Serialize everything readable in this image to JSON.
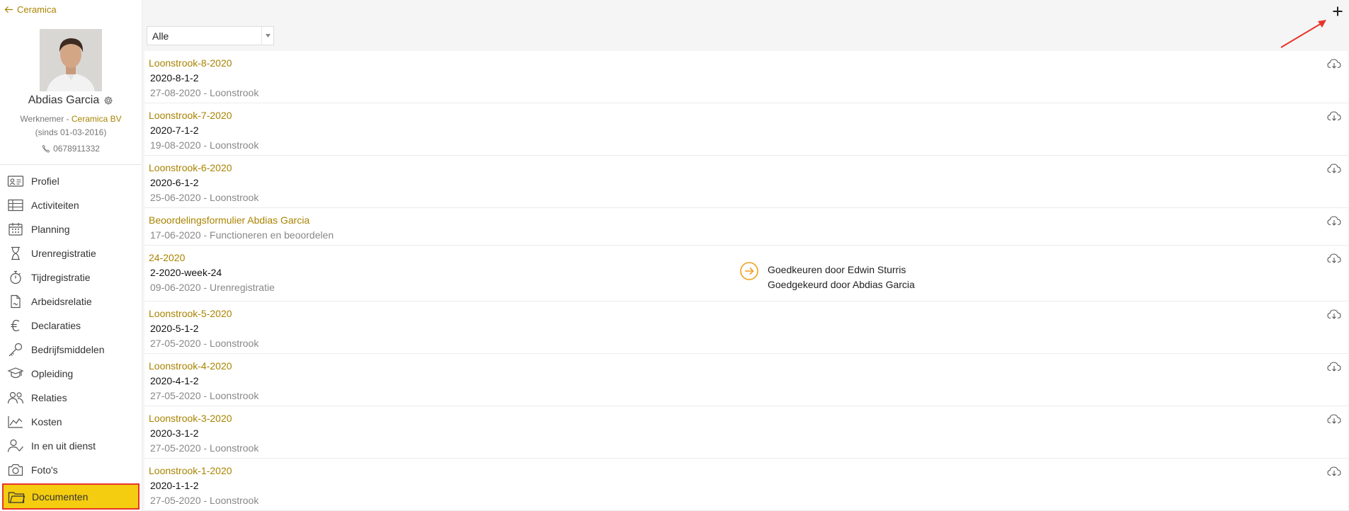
{
  "sidebar": {
    "back_label": "Ceramica",
    "user": {
      "name": "Abdias Garcia",
      "role": "Werknemer - ",
      "company": "Ceramica BV",
      "since": "(sinds 01-03-2016)",
      "phone": "0678911332"
    },
    "items": [
      {
        "label": "Profiel",
        "icon": "profile-card-icon"
      },
      {
        "label": "Activiteiten",
        "icon": "table-icon"
      },
      {
        "label": "Planning",
        "icon": "calendar-icon"
      },
      {
        "label": "Urenregistratie",
        "icon": "hourglass-icon"
      },
      {
        "label": "Tijdregistratie",
        "icon": "stopwatch-icon"
      },
      {
        "label": "Arbeidsrelatie",
        "icon": "document-icon"
      },
      {
        "label": "Declaraties",
        "icon": "euro-icon"
      },
      {
        "label": "Bedrijfsmiddelen",
        "icon": "key-icon"
      },
      {
        "label": "Opleiding",
        "icon": "graduation-icon"
      },
      {
        "label": "Relaties",
        "icon": "people-icon"
      },
      {
        "label": "Kosten",
        "icon": "area-chart-icon"
      },
      {
        "label": "In en uit dienst",
        "icon": "user-check-icon"
      },
      {
        "label": "Foto's",
        "icon": "camera-icon"
      },
      {
        "label": "Documenten",
        "icon": "folder-icon",
        "active": true
      }
    ]
  },
  "main": {
    "filter": {
      "selected": "Alle"
    },
    "documents": [
      {
        "title": "Loonstrook-8-2020",
        "sub": "2020-8-1-2",
        "meta": "27-08-2020 - Loonstrook"
      },
      {
        "title": "Loonstrook-7-2020",
        "sub": "2020-7-1-2",
        "meta": "19-08-2020 - Loonstrook"
      },
      {
        "title": "Loonstrook-6-2020",
        "sub": "2020-6-1-2",
        "meta": "25-06-2020 - Loonstrook"
      },
      {
        "title": "Beoordelingsformulier Abdias Garcia",
        "meta": "17-06-2020 - Functioneren en beoordelen"
      },
      {
        "title": "24-2020",
        "sub": "2-2020-week-24",
        "meta": "09-06-2020 - Urenregistratie",
        "approval": {
          "line1": "Goedkeuren door Edwin Sturris",
          "line2": "Goedgekeurd door Abdias Garcia"
        }
      },
      {
        "title": "Loonstrook-5-2020",
        "sub": "2020-5-1-2",
        "meta": "27-05-2020 - Loonstrook"
      },
      {
        "title": "Loonstrook-4-2020",
        "sub": "2020-4-1-2",
        "meta": "27-05-2020 - Loonstrook"
      },
      {
        "title": "Loonstrook-3-2020",
        "sub": "2020-3-1-2",
        "meta": "27-05-2020 - Loonstrook"
      },
      {
        "title": "Loonstrook-1-2020",
        "sub": "2020-1-1-2",
        "meta": "27-05-2020 - Loonstrook"
      }
    ]
  },
  "colors": {
    "accent": "#a98300",
    "active_bg": "#f4cc10",
    "highlight": "#e8352b",
    "approval": "#f0a020"
  }
}
